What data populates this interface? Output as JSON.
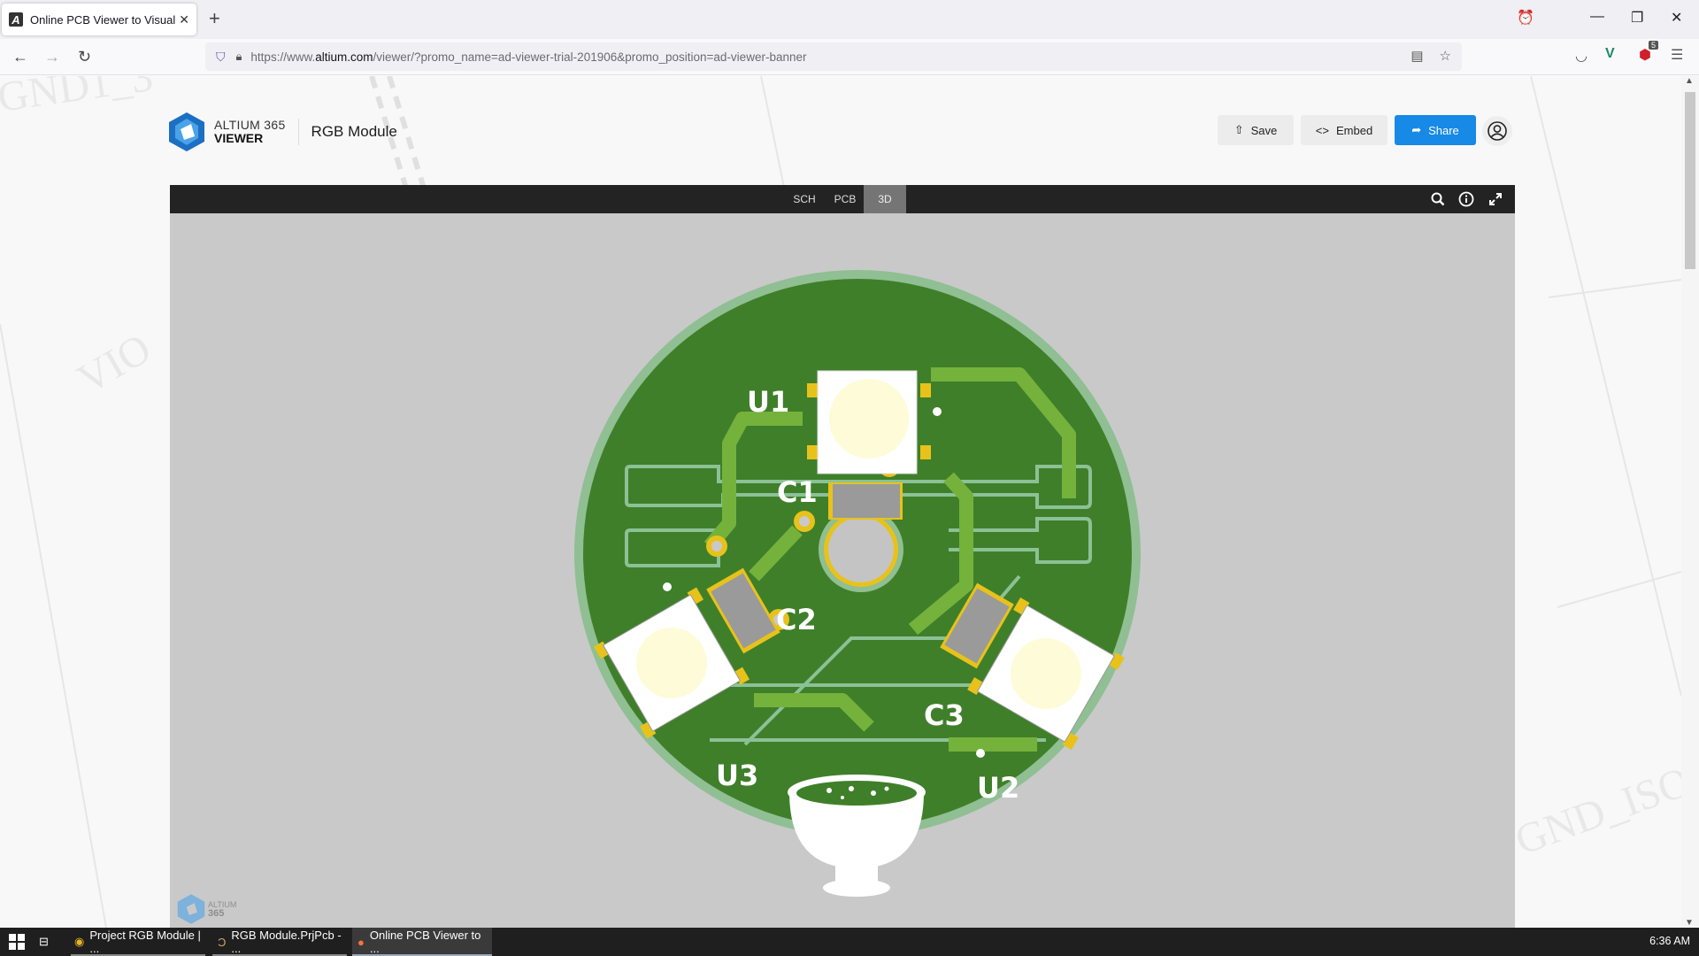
{
  "browser": {
    "tab_title": "Online PCB Viewer to Visualize a",
    "favicon_letter": "A",
    "url_prefix": "https://www.",
    "url_domain": "altium.com",
    "url_path": "/viewer/?promo_name=ad-viewer-trial-201906&promo_position=ad-viewer-banner",
    "extension_badge": "5"
  },
  "header": {
    "logo_line1": "ALTIUM 365",
    "logo_line2": "VIEWER",
    "project_title": "RGB Module",
    "buttons": {
      "save": "Save",
      "embed": "Embed",
      "share": "Share"
    }
  },
  "viewer": {
    "tabs": [
      {
        "label": "SCH",
        "active": false
      },
      {
        "label": "PCB",
        "active": false
      },
      {
        "label": "3D",
        "active": true
      }
    ],
    "watermark_line1": "ALTIUM",
    "watermark_line2": "365",
    "designators": {
      "u1": "U1",
      "u2": "U2",
      "u3": "U3",
      "c1": "C1",
      "c2": "C2",
      "c3": "C3"
    },
    "colors": {
      "board": "#3f7f2a",
      "board_edge": "#8fbf92",
      "trace": "#74b23c",
      "pad": "#e8c21a",
      "background": "#c9c9c9"
    }
  },
  "taskbar": {
    "items": [
      {
        "label": "Project RGB Module | ..."
      },
      {
        "label": "RGB Module.PrjPcb - ..."
      },
      {
        "label": "Online PCB Viewer to ..."
      }
    ],
    "clock": "6:36 AM"
  },
  "accent": "#1789e6"
}
